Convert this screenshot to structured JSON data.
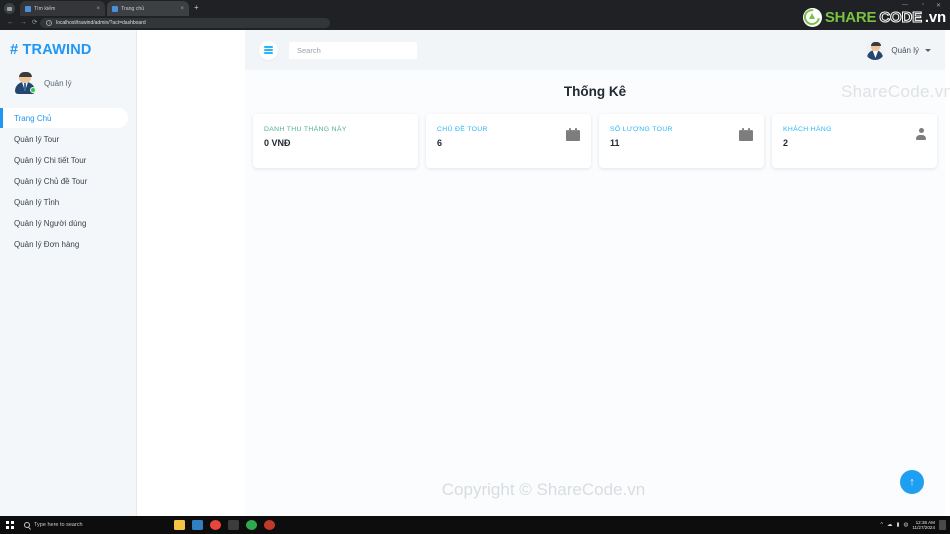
{
  "browser": {
    "tabs": [
      {
        "title": "Tìm kiếm",
        "close": "×"
      },
      {
        "title": "Trang chủ",
        "close": "×"
      }
    ],
    "new_tab": "+",
    "window_controls": {
      "minimize": "—",
      "maximize": "▫",
      "close": "✕"
    },
    "nav": {
      "back": "←",
      "forward": "→",
      "reload": "⟳"
    },
    "url": "localhost/trawind/admin/?act=dashboard"
  },
  "sidebar": {
    "logo": "# TRAWIND",
    "user_name": "Quản lý",
    "items": [
      {
        "label": "Trang Chủ",
        "active": true
      },
      {
        "label": "Quản lý Tour",
        "active": false
      },
      {
        "label": "Quản lý Chi tiết Tour",
        "active": false
      },
      {
        "label": "Quản lý Chủ đề Tour",
        "active": false
      },
      {
        "label": "Quản lý Tỉnh",
        "active": false
      },
      {
        "label": "Quản lý Người dùng",
        "active": false
      },
      {
        "label": "Quản lý Đơn hàng",
        "active": false
      }
    ]
  },
  "topbar": {
    "menu_toggle": "hamburger-icon",
    "search_placeholder": "Search",
    "user_name": "Quản lý",
    "dropdown_caret": "chevron-down-icon"
  },
  "main": {
    "title": "Thống Kê",
    "watermark_header": "ShareCode.vn",
    "watermark_footer": "Copyright © ShareCode.vn",
    "scroll_top": "↑",
    "cards": [
      {
        "label": "DANH THU THÁNG NÀY",
        "value": "0 VNĐ",
        "color": "#4caf90",
        "icon": ""
      },
      {
        "label": "CHỦ ĐỀ TOUR",
        "value": "6",
        "color": "#29b6f6",
        "icon": "calendar-icon"
      },
      {
        "label": "SỐ LƯỢNG TOUR",
        "value": "11",
        "color": "#29b6f6",
        "icon": "calendar-icon"
      },
      {
        "label": "KHÁCH HÀNG",
        "value": "2",
        "color": "#29b6f6",
        "icon": "person-icon"
      }
    ]
  },
  "sharecode_logo": {
    "part1": "SHARE",
    "part2": "CODE",
    "part3": ".vn"
  },
  "taskbar": {
    "search_placeholder": "Type here to search",
    "apps": [
      "file-explorer-icon",
      "vscode-icon",
      "chrome-icon",
      "terminal-icon",
      "app-green-icon",
      "app-red-icon"
    ],
    "tray": {
      "chevron": "^",
      "time": "12:36 AM",
      "date": "11/27/2024"
    }
  },
  "colors": {
    "accent_blue": "#2196f3",
    "sidebar_bg": "#f4f7fa",
    "panel_bg": "#fafcfd",
    "green": "#4caf90",
    "sharecode_green": "#7ac143"
  }
}
